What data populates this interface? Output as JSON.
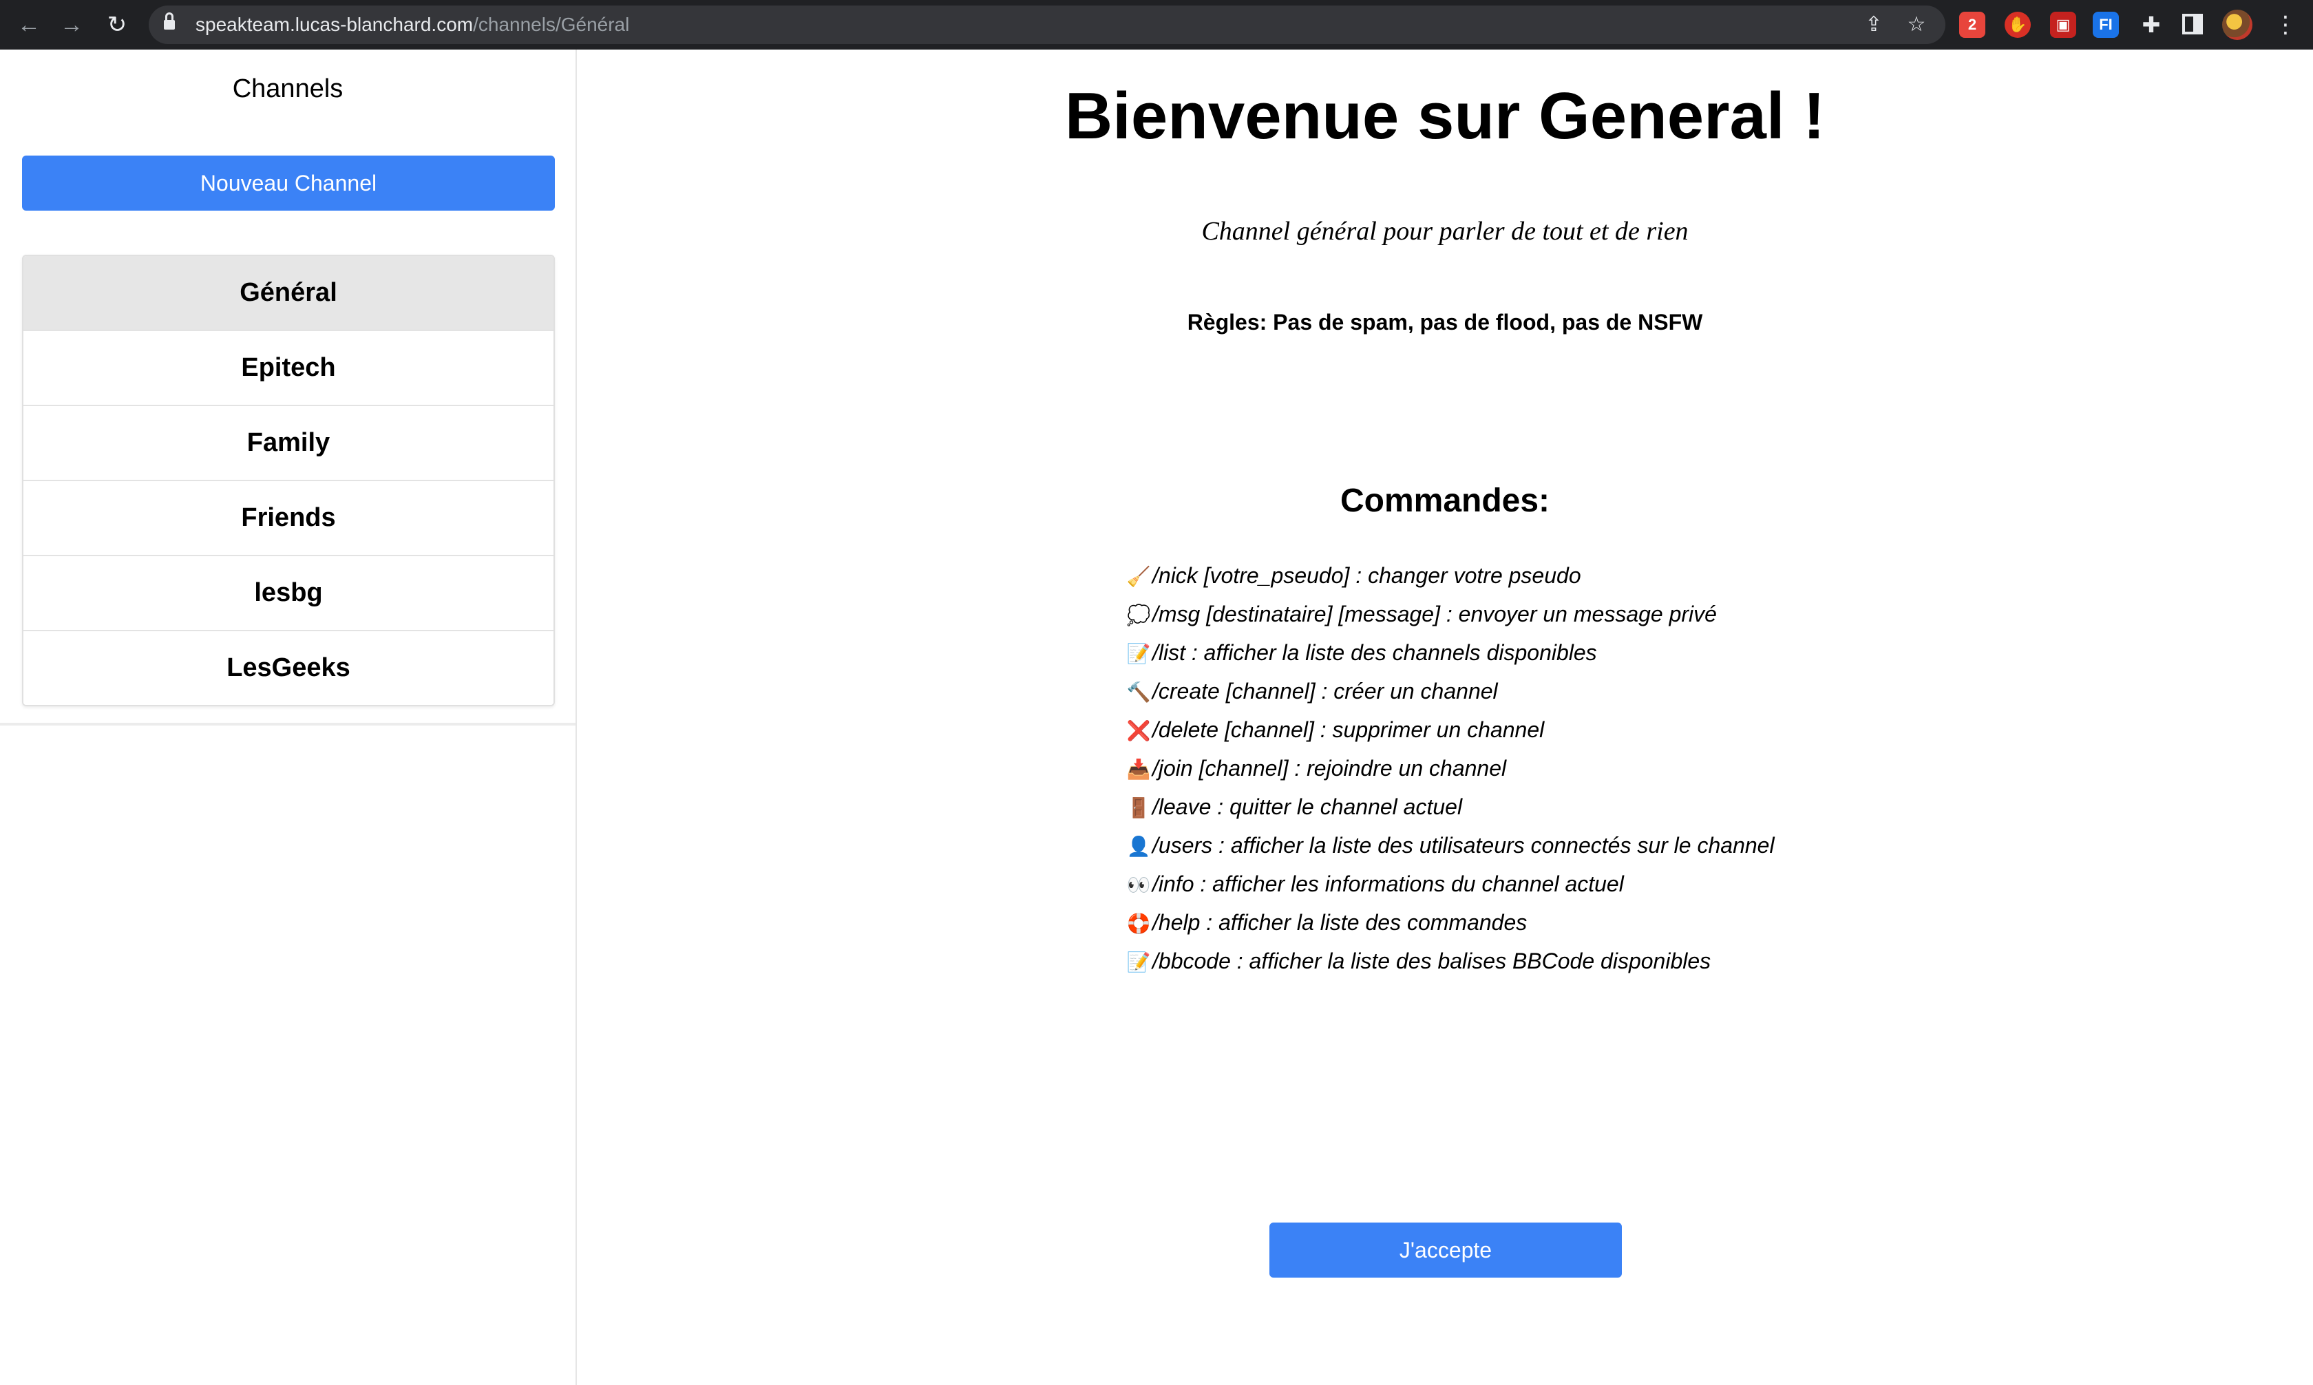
{
  "browser": {
    "url_host": "speakteam.lucas-blanchard.com",
    "url_path": "/channels/Général",
    "back_glyph": "←",
    "forward_glyph": "→",
    "reload_glyph": "↻",
    "share_glyph": "⇪",
    "star_glyph": "☆",
    "menu_glyph": "⋮",
    "extensions": [
      {
        "icon": "extension-red-icon",
        "glyph": "2"
      },
      {
        "icon": "adblock-hand-icon",
        "glyph": "✋"
      },
      {
        "icon": "extension-red-square-icon",
        "glyph": "▣"
      },
      {
        "icon": "extension-fi-icon",
        "glyph": "FI"
      },
      {
        "icon": "puzzle-extensions-icon",
        "glyph": "✚"
      }
    ]
  },
  "sidebar": {
    "title": "Channels",
    "new_channel_label": "Nouveau Channel",
    "channels": [
      {
        "label": "Général",
        "active": true
      },
      {
        "label": "Epitech",
        "active": false
      },
      {
        "label": "Family",
        "active": false
      },
      {
        "label": "Friends",
        "active": false
      },
      {
        "label": "lesbg",
        "active": false
      },
      {
        "label": "LesGeeks",
        "active": false
      }
    ]
  },
  "main": {
    "welcome": "Bienvenue sur General !",
    "description": "Channel général pour parler de tout et de rien",
    "rules": "Règles: Pas de spam, pas de flood, pas de NSFW",
    "commands_title": "Commandes:",
    "commands": [
      {
        "icon": "broom-icon",
        "glyph": "🧹",
        "text": "/nick [votre_pseudo] : changer votre pseudo"
      },
      {
        "icon": "speech-bubble-icon",
        "glyph": "💭",
        "text": "/msg [destinataire] [message] : envoyer un message privé"
      },
      {
        "icon": "memo-icon",
        "glyph": "📝",
        "text": "/list : afficher la liste des channels disponibles"
      },
      {
        "icon": "hammer-icon",
        "glyph": "🔨",
        "text": "/create [channel] : créer un channel"
      },
      {
        "icon": "cross-mark-icon",
        "glyph": "❌",
        "text": "/delete [channel] : supprimer un channel"
      },
      {
        "icon": "inbox-tray-icon",
        "glyph": "📥",
        "text": "/join [channel] : rejoindre un channel"
      },
      {
        "icon": "door-icon",
        "glyph": "🚪",
        "text": "/leave : quitter le channel actuel"
      },
      {
        "icon": "user-silhouette-icon",
        "glyph": "👤",
        "text": "/users : afficher la liste des utilisateurs connectés sur le channel"
      },
      {
        "icon": "eyes-icon",
        "glyph": "👀",
        "text": "/info : afficher les informations du channel actuel"
      },
      {
        "icon": "lifebuoy-icon",
        "glyph": "🛟",
        "text": "/help : afficher la liste des commandes"
      },
      {
        "icon": "memo-icon",
        "glyph": "📝",
        "text": "/bbcode : afficher la liste des balises BBCode disponibles"
      }
    ],
    "accept_label": "J'accepte"
  },
  "colors": {
    "accent": "#3b82f6",
    "active_channel_bg": "#e6e6e6",
    "chrome_bg": "#202124"
  }
}
